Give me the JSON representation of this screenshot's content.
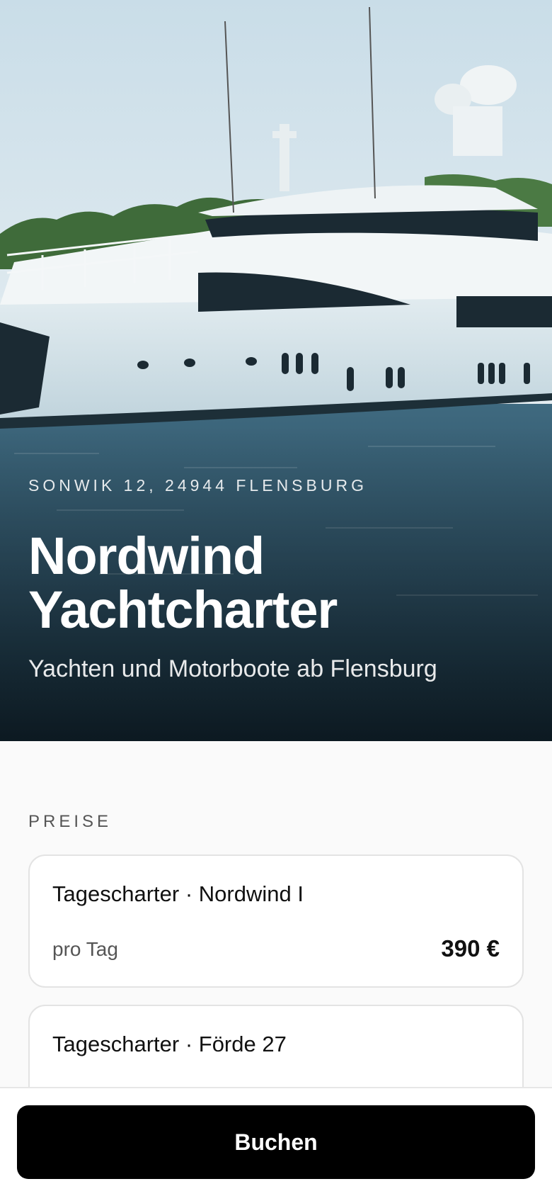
{
  "hero": {
    "address": "SONWIK 12, 24944 FLENSBURG",
    "title_line1": "Nordwind",
    "title_line2": "Yachtcharter",
    "subtitle": "Yachten und Motorboote ab Flensburg"
  },
  "prices": {
    "section_label": "PREISE",
    "items": [
      {
        "title": "Tagescharter · Nordwind I",
        "unit": "pro Tag",
        "price": "390 €"
      },
      {
        "title": "Tagescharter · Förde 27",
        "unit": "",
        "price": ""
      }
    ]
  },
  "bottom_bar": {
    "book_label": "Buchen"
  },
  "colors": {
    "accent": "#000000",
    "background": "#fafafa",
    "card_border": "#e3e3e3"
  }
}
